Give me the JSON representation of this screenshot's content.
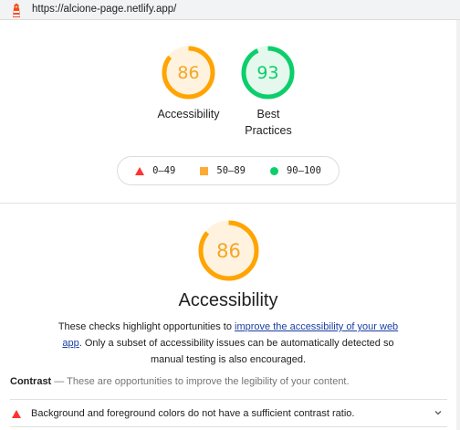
{
  "browser": {
    "url": "https://alcione-page.netlify.app/"
  },
  "summary": {
    "gauges": [
      {
        "score": "86",
        "fraction": 0.86,
        "label": "Accessibility",
        "color": "#ffa400",
        "fill": "#fff3e0",
        "text_color": "#c33300"
      },
      {
        "score": "93",
        "fraction": 0.93,
        "label": "Best Practices",
        "color": "#0cce6b",
        "fill": "#e5f8ee",
        "text_color": "#008800"
      }
    ]
  },
  "legend": {
    "fail": "0–49",
    "average": "50–89",
    "pass": "90–100",
    "colors": {
      "fail": "#ff3333",
      "average": "#ffaa33",
      "pass": "#0cce6b"
    }
  },
  "category": {
    "score": "86",
    "fraction": 0.86,
    "title": "Accessibility",
    "description_pre": "These checks highlight opportunities to ",
    "description_link": "improve the accessibility of your web app",
    "description_post": ". Only a subset of accessibility issues can be automatically detected so manual testing is also encouraged."
  },
  "group": {
    "title": "Contrast",
    "separator": " — ",
    "description": "These are opportunities to improve the legibility of your content."
  },
  "audits": [
    {
      "text": "Background and foreground colors do not have a sufficient contrast ratio.",
      "status": "fail"
    }
  ]
}
